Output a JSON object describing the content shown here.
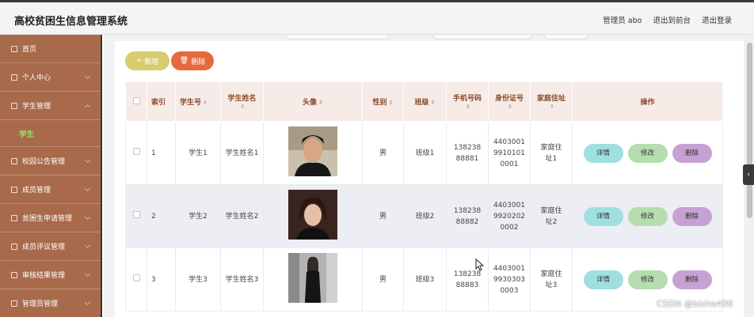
{
  "app": {
    "title": "高校贫困生信息管理系统"
  },
  "topnav": {
    "user": "管理员 abo",
    "front": "退出到前台",
    "logout": "退出登录"
  },
  "sidebar": {
    "items": [
      {
        "label": "首页"
      },
      {
        "label": "个人中心"
      },
      {
        "label": "学生管理"
      },
      {
        "label": "学生"
      },
      {
        "label": "校园公告管理"
      },
      {
        "label": "成员管理"
      },
      {
        "label": "贫困生申请管理"
      },
      {
        "label": "成员评议管理"
      },
      {
        "label": "审核结果管理"
      },
      {
        "label": "管理员管理"
      }
    ]
  },
  "toolbar": {
    "add": "新增",
    "delete": "删除",
    "add_icon": "+",
    "delete_icon": "🗑"
  },
  "table": {
    "headers": [
      "索引",
      "学生号",
      "学生姓名",
      "头像",
      "性别",
      "班级",
      "手机号码",
      "身份证号",
      "家庭住址",
      "操作"
    ],
    "sort_icon": "⇕",
    "rows": [
      {
        "index": "1",
        "student_no": "学生1",
        "name": "学生姓名1",
        "gender": "男",
        "class": "班级1",
        "phone": "13823888881",
        "id": "440300199101010001",
        "address": "家庭住址1"
      },
      {
        "index": "2",
        "student_no": "学生2",
        "name": "学生姓名2",
        "gender": "男",
        "class": "班级2",
        "phone": "13823888882",
        "id": "440300199202020002",
        "address": "家庭住址2"
      },
      {
        "index": "3",
        "student_no": "学生3",
        "name": "学生姓名3",
        "gender": "男",
        "class": "班级3",
        "phone": "13823888883",
        "id": "440300199303030003",
        "address": "家庭住址3"
      }
    ],
    "actions": {
      "detail": "详情",
      "edit": "修改",
      "delete": "删除"
    }
  },
  "collapse_handle": "‹",
  "watermark": "CSDN @bishe409",
  "colors": {
    "sidebar": "#a86a4b",
    "header_bg": "#f6ebe6",
    "add": "#d9cc6e",
    "delete": "#e46a3c",
    "detail": "#9fdfe2",
    "edit": "#b5ddb0",
    "remove": "#c7a1d3"
  }
}
